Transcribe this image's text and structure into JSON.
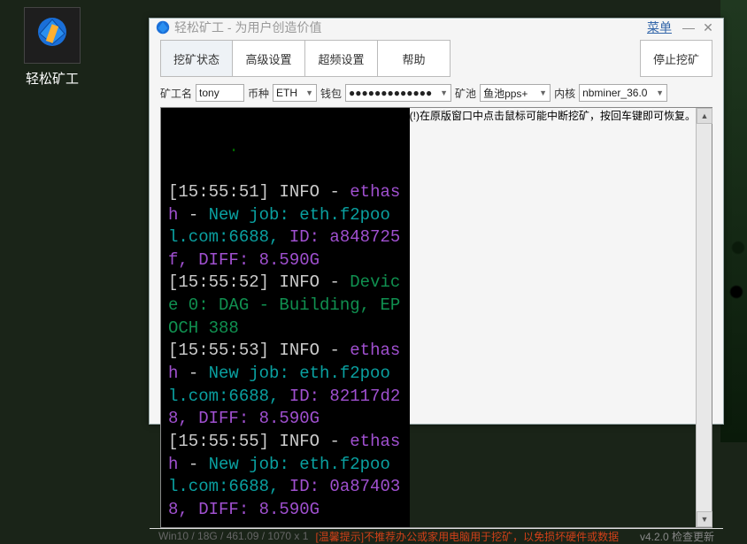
{
  "desktop_icon": {
    "label": "轻松矿工"
  },
  "window": {
    "title": "轻松矿工 - 为用户创造价值",
    "menu_label": "菜单",
    "tabs": {
      "status": "挖矿状态",
      "advanced": "高级设置",
      "overclock": "超频设置",
      "help": "帮助"
    },
    "stop_button": "停止挖矿"
  },
  "fields": {
    "worker_label": "矿工名",
    "worker_value": "tony",
    "coin_label": "币种",
    "coin_value": "ETH",
    "wallet_label": "钱包",
    "wallet_value": "●●●●●●●●●●●●●",
    "pool_label": "矿池",
    "pool_value": "鱼池pps+",
    "kernel_label": "内核",
    "kernel_value": "nbminer_36.0"
  },
  "terminal": {
    "lines": [
      {
        "ts": "[15:55:51]",
        "level": "INFO",
        "body_html": "<span class='eth'>ethash</span> <span class='dash'>-</span> <span class='job'>New job: eth.f2pool.com:6688,</span> <span class='id'>ID: a848725f, DIFF: 8.590G</span>"
      },
      {
        "ts": "[15:55:52]",
        "level": "INFO",
        "body_html": "<span class='dev'>Device 0: DAG - Building, EPOCH 388</span>"
      },
      {
        "ts": "[15:55:53]",
        "level": "INFO",
        "body_html": "<span class='eth'>ethash</span> <span class='dash'>-</span> <span class='job'>New job: eth.f2pool.com:6688,</span> <span class='id'>ID: 82117d28, DIFF: 8.590G</span>"
      },
      {
        "ts": "[15:55:55]",
        "level": "INFO",
        "body_html": "<span class='eth'>ethash</span> <span class='dash'>-</span> <span class='job'>New job: eth.f2pool.com:6688,</span> <span class='id'>ID: 0a874038, DIFF: 8.590G</span>"
      }
    ],
    "hint": "(!)在原版窗口中点击鼠标可能中断挖矿，按回车键即可恢复。"
  },
  "status": {
    "sys": "Win10  /  18G / 461.09  / 1070 x 1",
    "warn": "[温馨提示]不推荐办公或家用电脑用于挖矿，以免损坏硬件或数据",
    "version": "v4.2.0 检查更新"
  }
}
